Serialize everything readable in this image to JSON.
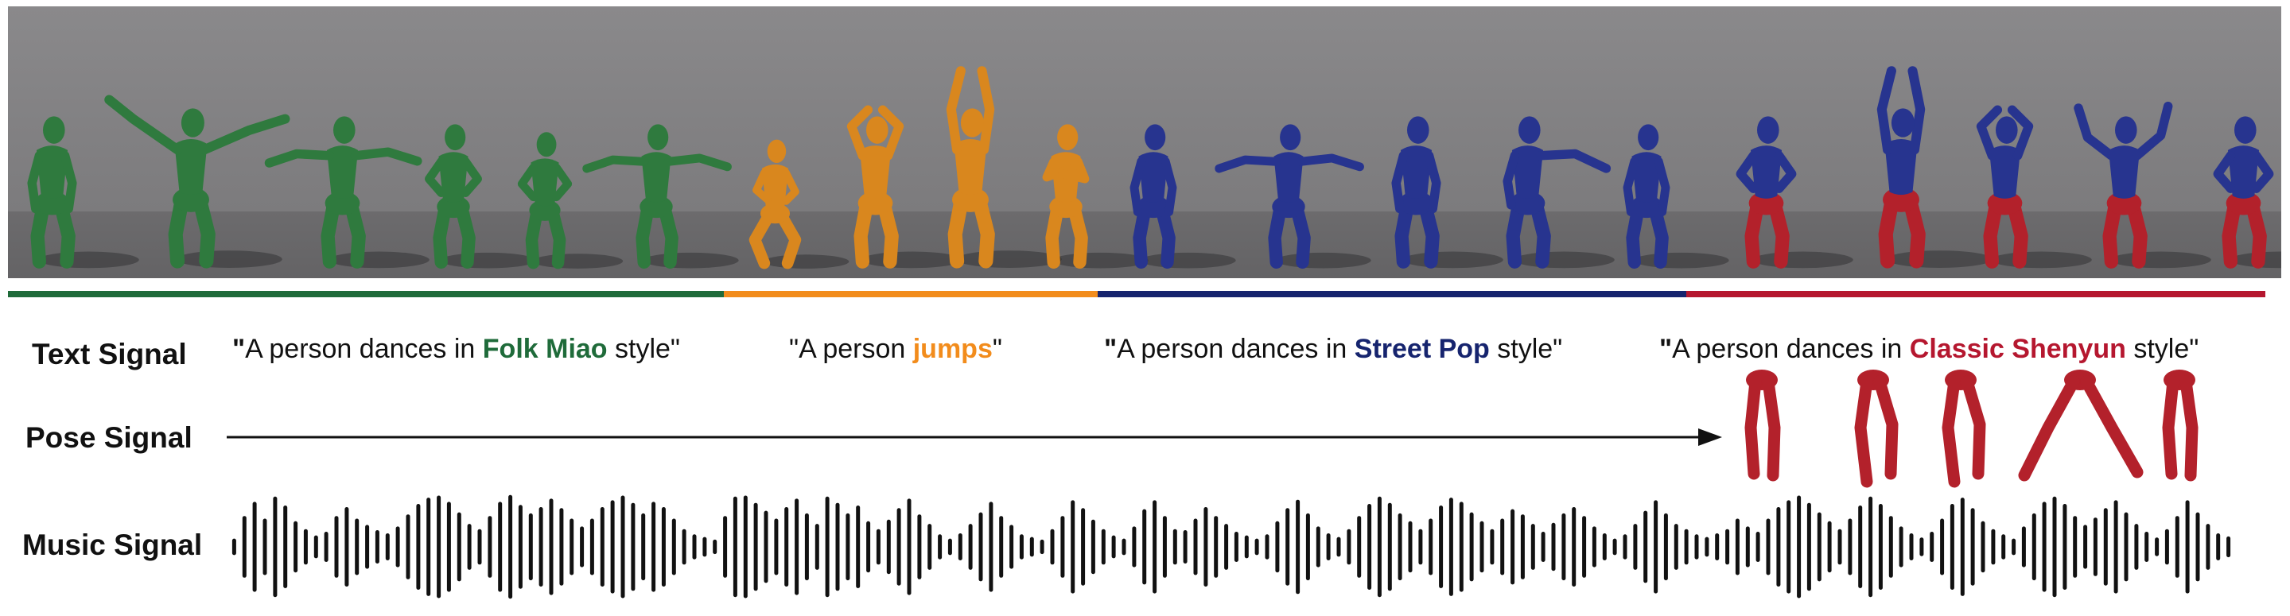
{
  "colors": {
    "folk": "#1f6b3a",
    "jump": "#f28c1c",
    "street": "#16246e",
    "shenyun": "#b5172f",
    "text": "#111111"
  },
  "segments": [
    {
      "name": "folk",
      "color": "#1f6b3a"
    },
    {
      "name": "jump",
      "color": "#f28c1c"
    },
    {
      "name": "street",
      "color": "#16246e"
    },
    {
      "name": "shenyun",
      "color": "#b5172f"
    }
  ],
  "labels": {
    "text_signal": "Text Signal",
    "pose_signal": "Pose Signal",
    "music_signal": "Music Signal"
  },
  "prompts": [
    {
      "open_quote": "\"",
      "before": "A person dances in ",
      "keyword": "Folk Miao",
      "after": " style\"",
      "color_key": "folk"
    },
    {
      "open_quote": "\"",
      "before": "A person ",
      "keyword": "jumps",
      "after": "\"",
      "color_key": "jump"
    },
    {
      "open_quote": "\"",
      "before": "A person dances in ",
      "keyword": "Street Pop",
      "after": " style\"",
      "color_key": "street"
    },
    {
      "open_quote": "\"",
      "before": "A person dances in ",
      "keyword": "Classic Shenyun",
      "after": " style\"",
      "color_key": "shenyun"
    }
  ],
  "dancers": [
    {
      "color": "#2f7a3e",
      "pose": "arms-down"
    },
    {
      "color": "#2f7a3e",
      "pose": "arms-out-up"
    },
    {
      "color": "#2f7a3e",
      "pose": "arms-out"
    },
    {
      "color": "#2f7a3e",
      "pose": "hands-hips"
    },
    {
      "color": "#2f7a3e",
      "pose": "hands-hips"
    },
    {
      "color": "#2f7a3e",
      "pose": "arms-out"
    },
    {
      "color": "#d9871e",
      "pose": "crouch"
    },
    {
      "color": "#d9871e",
      "pose": "hands-head"
    },
    {
      "color": "#d9871e",
      "pose": "arms-up"
    },
    {
      "color": "#d9871e",
      "pose": "hands-chest"
    },
    {
      "color": "#27348f",
      "pose": "arms-down"
    },
    {
      "color": "#27348f",
      "pose": "arms-out"
    },
    {
      "color": "#27348f",
      "pose": "arms-down"
    },
    {
      "color": "#27348f",
      "pose": "one-arm-out"
    },
    {
      "color": "#27348f",
      "pose": "arms-down"
    },
    {
      "color": "#27348f",
      "top_color": "#27348f",
      "leg_color": "#b3212b",
      "pose": "hands-hips"
    },
    {
      "color": "#27348f",
      "top_color": "#27348f",
      "leg_color": "#b3212b",
      "pose": "arms-up"
    },
    {
      "color": "#27348f",
      "top_color": "#27348f",
      "leg_color": "#b3212b",
      "pose": "hands-head"
    },
    {
      "color": "#27348f",
      "top_color": "#27348f",
      "leg_color": "#b3212b",
      "pose": "one-arm-up"
    },
    {
      "color": "#27348f",
      "top_color": "#27348f",
      "leg_color": "#b3212b",
      "pose": "hands-hips"
    }
  ],
  "pose_legs": [
    {
      "color": "#b3212b",
      "stance": "narrow"
    },
    {
      "color": "#b3212b",
      "stance": "step"
    },
    {
      "color": "#b3212b",
      "stance": "step"
    },
    {
      "color": "#b3212b",
      "stance": "wide"
    },
    {
      "color": "#b3212b",
      "stance": "narrow"
    }
  ],
  "music": {
    "bar_heights": [
      0.12,
      0.55,
      0.82,
      0.5,
      0.92,
      0.75,
      0.45,
      0.3,
      0.18,
      0.25,
      0.55,
      0.72,
      0.5,
      0.38,
      0.28,
      0.22,
      0.35,
      0.58,
      0.78,
      0.9,
      0.94,
      0.82,
      0.62,
      0.4,
      0.3,
      0.55,
      0.82,
      0.95,
      0.76,
      0.6,
      0.72,
      0.88,
      0.7,
      0.5,
      0.35,
      0.5,
      0.72,
      0.85,
      0.94,
      0.8,
      0.6,
      0.82,
      0.72,
      0.5,
      0.3,
      0.2,
      0.15,
      0.1,
      0.55,
      0.92,
      0.94,
      0.8,
      0.65,
      0.5,
      0.72,
      0.88,
      0.6,
      0.4,
      0.92,
      0.8,
      0.6,
      0.75,
      0.45,
      0.3,
      0.48,
      0.7,
      0.88,
      0.58,
      0.4,
      0.2,
      0.12,
      0.22,
      0.4,
      0.62,
      0.82,
      0.55,
      0.38,
      0.2,
      0.15,
      0.1,
      0.3,
      0.55,
      0.85,
      0.7,
      0.48,
      0.3,
      0.18,
      0.12,
      0.35,
      0.68,
      0.85,
      0.55,
      0.3,
      0.28,
      0.5,
      0.72,
      0.55,
      0.4,
      0.25,
      0.18,
      0.12,
      0.2,
      0.45,
      0.7,
      0.86,
      0.6,
      0.35,
      0.22,
      0.15,
      0.3,
      0.55,
      0.78,
      0.92,
      0.8,
      0.6,
      0.45,
      0.3,
      0.5,
      0.75,
      0.9,
      0.82,
      0.62,
      0.45,
      0.3,
      0.5,
      0.68,
      0.58,
      0.4,
      0.25,
      0.42,
      0.6,
      0.72,
      0.55,
      0.35,
      0.22,
      0.12,
      0.2,
      0.4,
      0.65,
      0.85,
      0.6,
      0.4,
      0.3,
      0.2,
      0.15,
      0.22,
      0.3,
      0.5,
      0.35,
      0.25,
      0.5,
      0.72,
      0.85,
      0.94,
      0.8,
      0.62,
      0.45,
      0.3,
      0.5,
      0.75,
      0.92,
      0.78,
      0.55,
      0.35,
      0.22,
      0.14,
      0.25,
      0.5,
      0.78,
      0.9,
      0.7,
      0.45,
      0.3,
      0.2,
      0.12,
      0.35,
      0.6,
      0.82,
      0.92,
      0.78,
      0.55,
      0.38,
      0.52,
      0.7,
      0.85,
      0.62,
      0.4,
      0.25,
      0.14,
      0.3,
      0.55,
      0.85,
      0.62,
      0.4,
      0.22,
      0.16
    ]
  }
}
